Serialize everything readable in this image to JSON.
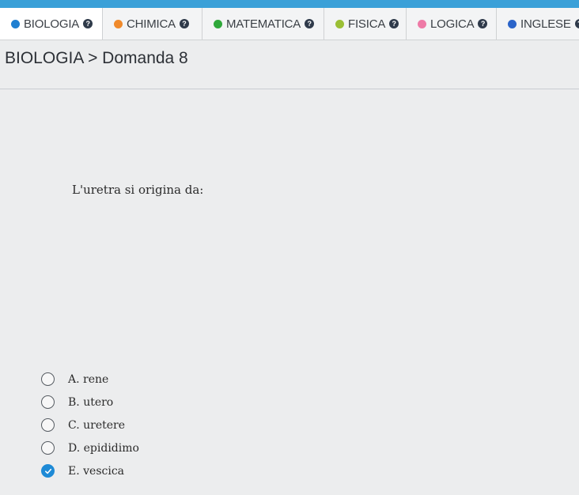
{
  "tabs": [
    {
      "label": "BIOLOGIA",
      "color": "#1f7fd1",
      "active": true
    },
    {
      "label": "CHIMICA",
      "color": "#f08a2b",
      "active": false
    },
    {
      "label": "MATEMATICA",
      "color": "#2fa83a",
      "active": false
    },
    {
      "label": "FISICA",
      "color": "#9bbf35",
      "active": false
    },
    {
      "label": "LOGICA",
      "color": "#ee7aa6",
      "active": false
    },
    {
      "label": "INGLESE",
      "color": "#2b64c9",
      "active": false
    }
  ],
  "info_icon_glyph": "?",
  "breadcrumb": {
    "subject": "BIOLOGIA",
    "separator": ">",
    "item": "Domanda 8"
  },
  "question": {
    "text": "L'uretra si origina da:"
  },
  "options": [
    {
      "label": "A. rene",
      "selected": false
    },
    {
      "label": "B. utero",
      "selected": false
    },
    {
      "label": "C. uretere",
      "selected": false
    },
    {
      "label": "D. epididimo",
      "selected": false
    },
    {
      "label": "E. vescica",
      "selected": true
    }
  ],
  "colors": {
    "accent": "#3aa0d8",
    "selected_radio": "#1e8ad6"
  }
}
